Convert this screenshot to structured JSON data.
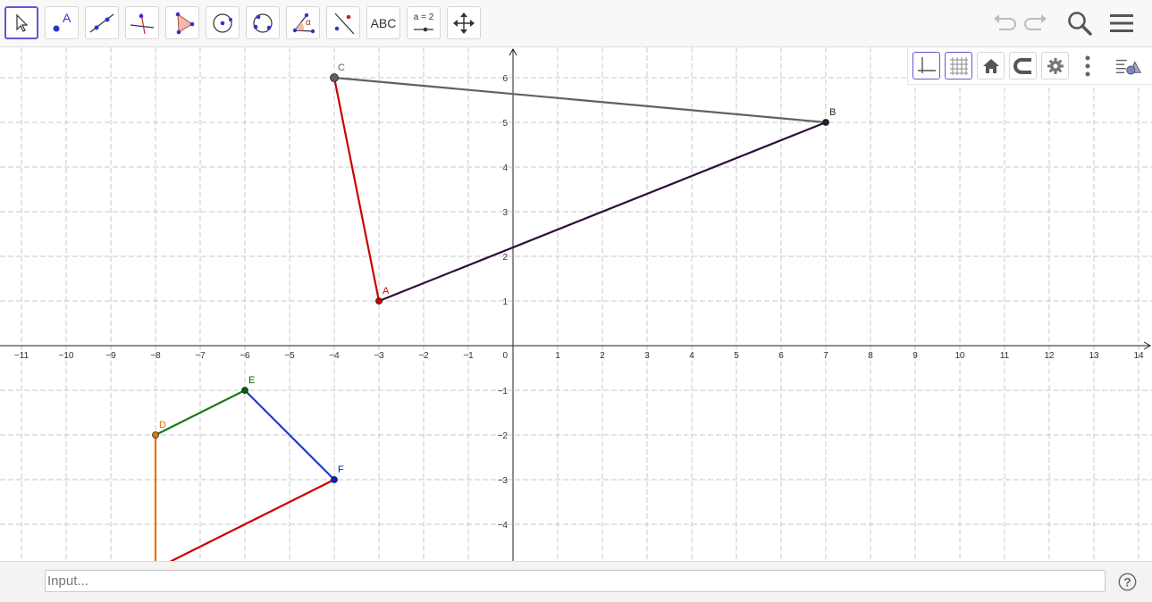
{
  "toolbar": {
    "tools": [
      {
        "name": "move-tool"
      },
      {
        "name": "point-tool",
        "letter": "A"
      },
      {
        "name": "line-tool"
      },
      {
        "name": "perpendicular-line-tool"
      },
      {
        "name": "polygon-tool"
      },
      {
        "name": "circle-center-point-tool"
      },
      {
        "name": "circle-three-points-tool"
      },
      {
        "name": "angle-tool",
        "symbol": "α"
      },
      {
        "name": "reflect-about-line-tool"
      },
      {
        "name": "text-tool",
        "label": "ABC"
      },
      {
        "name": "slider-tool",
        "label": "a = 2"
      },
      {
        "name": "move-graphics-view-tool"
      }
    ]
  },
  "input": {
    "placeholder": "Input..."
  },
  "help": {
    "label": "?"
  },
  "graph": {
    "x_ticks": [
      -11,
      -10,
      -9,
      -8,
      -7,
      -6,
      -5,
      -4,
      -3,
      -2,
      -1,
      1,
      2,
      3,
      4,
      5,
      6,
      7,
      8,
      9,
      10,
      11,
      12,
      13,
      14
    ],
    "y_ticks": [
      6,
      5,
      4,
      3,
      2,
      1,
      -1,
      -2,
      -3,
      -4
    ],
    "origin_label": "0",
    "points": [
      {
        "label": "A",
        "x": -3,
        "y": 1,
        "color": "#cc0000"
      },
      {
        "label": "B",
        "x": 7,
        "y": 5,
        "color": "#222222"
      },
      {
        "label": "C",
        "x": -4,
        "y": 6,
        "color": "#616161"
      },
      {
        "label": "D",
        "x": -8,
        "y": -2,
        "color": "#e67300"
      },
      {
        "label": "E",
        "x": -6,
        "y": -1,
        "color": "#006600"
      },
      {
        "label": "F",
        "x": -4,
        "y": -3,
        "color": "#0022cc"
      }
    ],
    "segments": [
      {
        "from": [
          -4,
          6
        ],
        "to": [
          7,
          5
        ],
        "color": "#616161"
      },
      {
        "from": [
          -3,
          1
        ],
        "to": [
          -4,
          6
        ],
        "color": "#cc0000"
      },
      {
        "from": [
          -3,
          1
        ],
        "to": [
          7,
          5
        ],
        "color": "#2b0d3b"
      },
      {
        "from": [
          -8,
          -2
        ],
        "to": [
          -6,
          -1
        ],
        "color": "#1e7a1e"
      },
      {
        "from": [
          -6,
          -1
        ],
        "to": [
          -4,
          -3
        ],
        "color": "#1a3fcc"
      },
      {
        "from": [
          -4,
          -3
        ],
        "to": [
          -8,
          -5
        ],
        "color": "#cc0000"
      },
      {
        "from": [
          -8,
          -2
        ],
        "to": [
          -8,
          -5
        ],
        "color": "#e67300"
      }
    ]
  }
}
